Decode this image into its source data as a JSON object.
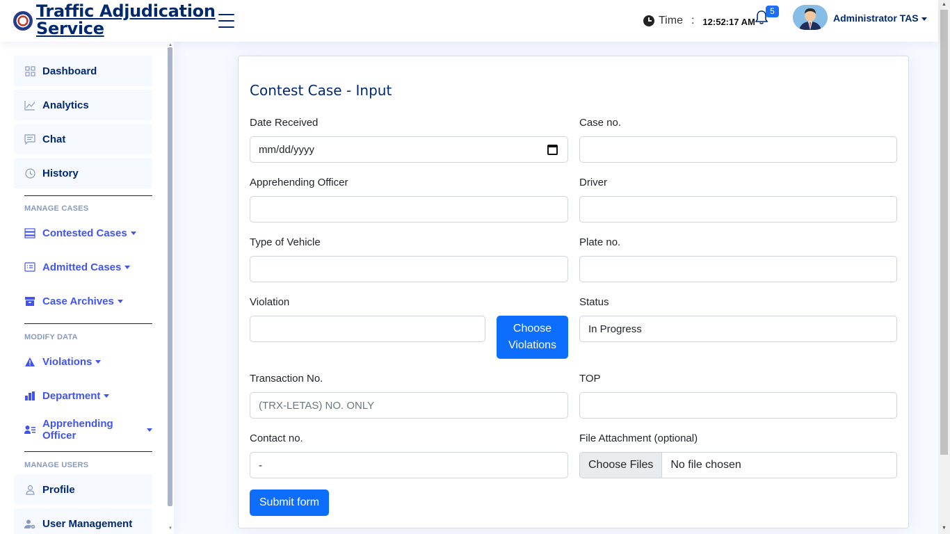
{
  "header": {
    "app_title_line1": "Traffic Adjudication",
    "app_title_line2": "Service",
    "time_label": "Time",
    "time_separator": ":",
    "time_value": "12:52:17 AM",
    "notification_count": "5",
    "user_name": "Administrator TAS"
  },
  "sidebar": {
    "items": [
      {
        "label": "Dashboard",
        "icon": "grid-icon"
      },
      {
        "label": "Analytics",
        "icon": "chart-line-icon"
      },
      {
        "label": "Chat",
        "icon": "chat-icon"
      },
      {
        "label": "History",
        "icon": "clock-icon"
      }
    ],
    "heading_manage_cases": "MANAGE CASES",
    "manage_cases": [
      {
        "label": "Contested Cases",
        "icon": "stack-icon"
      },
      {
        "label": "Admitted Cases",
        "icon": "card-list-icon"
      },
      {
        "label": "Case Archives",
        "icon": "archive-icon"
      }
    ],
    "heading_modify_data": "MODIFY DATA",
    "modify_data": [
      {
        "label": "Violations",
        "icon": "warning-icon"
      },
      {
        "label": "Department",
        "icon": "building-icon"
      },
      {
        "label": "Apprehending Officer",
        "icon": "person-lines-icon"
      }
    ],
    "heading_manage_users": "MANAGE USERS",
    "manage_users": [
      {
        "label": "Profile",
        "icon": "person-icon"
      },
      {
        "label": "User Management",
        "icon": "person-gear-icon"
      }
    ]
  },
  "form": {
    "title": "Contest Case - Input",
    "date_received_label": "Date Received",
    "date_received_value": "mm/dd/yyyy",
    "case_no_label": "Case no.",
    "apprehending_officer_label": "Apprehending Officer",
    "driver_label": "Driver",
    "type_of_vehicle_label": "Type of Vehicle",
    "plate_no_label": "Plate no.",
    "violation_label": "Violation",
    "choose_violations_line1": "Choose",
    "choose_violations_line2": "Violations",
    "status_label": "Status",
    "status_value": "In Progress",
    "transaction_no_label": "Transaction No.",
    "transaction_no_placeholder": "(TRX-LETAS) NO. ONLY",
    "top_label": "TOP",
    "contact_no_label": "Contact no.",
    "contact_no_value": "-",
    "file_attachment_label": "File Attachment (optional)",
    "choose_files_label": "Choose Files",
    "no_file_text": "No file chosen",
    "submit_label": "Submit form"
  },
  "colors": {
    "brand": "#012970",
    "accent": "#4154f1",
    "primary_button": "#0d6efd"
  }
}
